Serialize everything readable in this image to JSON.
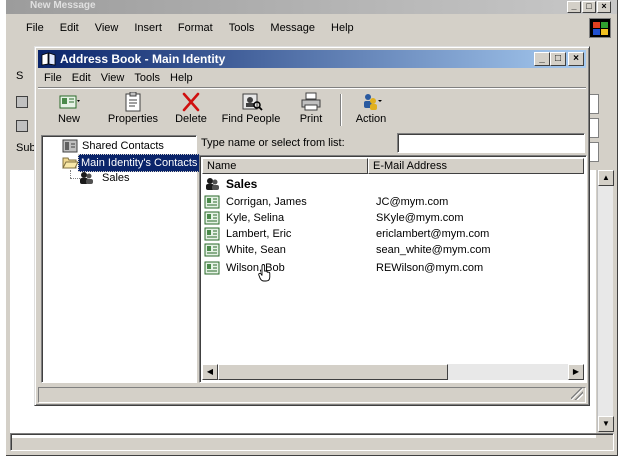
{
  "background_window": {
    "title_fragment": "New Message",
    "menu": [
      "File",
      "Edit",
      "View",
      "Insert",
      "Format",
      "Tools",
      "Message",
      "Help"
    ],
    "left_fragments": [
      "S",
      "Sub"
    ]
  },
  "address_book": {
    "title": "Address Book - Main Identity",
    "menu": [
      "File",
      "Edit",
      "View",
      "Tools",
      "Help"
    ],
    "toolbar": {
      "new": "New",
      "properties": "Properties",
      "delete": "Delete",
      "find_people": "Find People",
      "print": "Print",
      "action": "Action"
    },
    "tree": {
      "shared": "Shared Contacts",
      "main": "Main Identity's Contacts",
      "sales": "Sales"
    },
    "search": {
      "label": "Type name or select from list:",
      "value": ""
    },
    "columns": {
      "name": "Name",
      "email": "E-Mail Address"
    },
    "group": "Sales",
    "contacts": [
      {
        "name": "Corrigan, James",
        "email": "JC@mym.com"
      },
      {
        "name": "Kyle, Selina",
        "email": "SKyle@mym.com"
      },
      {
        "name": "Lambert, Eric",
        "email": "ericlambert@mym.com"
      },
      {
        "name": "White, Sean",
        "email": "sean_white@mym.com"
      },
      {
        "name": "Wilson, Bob",
        "email": "REWilson@mym.com"
      }
    ]
  }
}
